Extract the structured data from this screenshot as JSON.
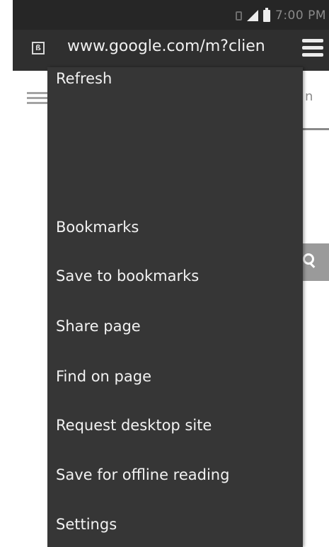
{
  "status_bar": {
    "time": "7:00 PM",
    "icons": [
      "sim-icon",
      "signal-icon",
      "battery-icon"
    ]
  },
  "address_bar": {
    "url": "www.google.com/m?clien",
    "site_icon": "page-icon",
    "menu_icon": "tabs-icon"
  },
  "page": {
    "signin_fragment": "n",
    "menu_icon": "hamburger-icon",
    "search_icon": "search-icon"
  },
  "menu": {
    "items": [
      "Refresh",
      "Bookmarks",
      "Save to bookmarks",
      "Share page",
      "Find on page",
      "Request desktop site",
      "Save for offline reading",
      "Settings"
    ]
  },
  "colors": {
    "menu_background": "#363636",
    "action_bar": "#2f2f2f",
    "status_bar": "#262626",
    "menu_text": "#f2f2f2"
  }
}
